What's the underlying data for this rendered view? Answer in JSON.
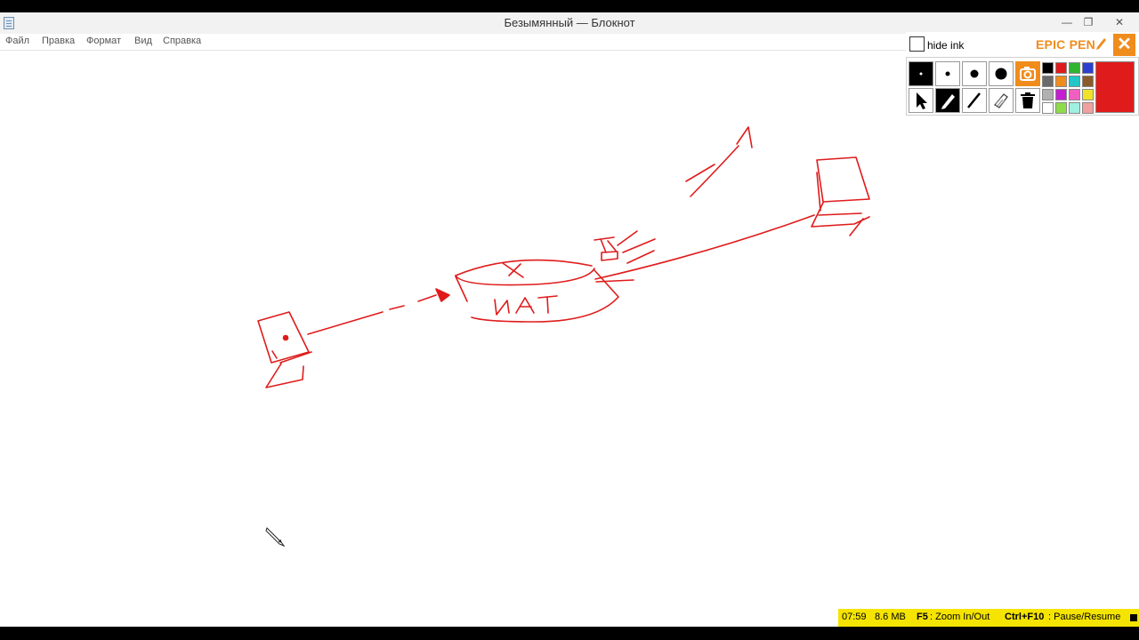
{
  "window": {
    "title": "Безымянный — Блокнот",
    "minimize_glyph": "—",
    "restore_glyph": "❐",
    "close_glyph": "✕"
  },
  "menu": [
    {
      "label": "Файл"
    },
    {
      "label": "Правка"
    },
    {
      "label": "Формат"
    },
    {
      "label": "Вид"
    },
    {
      "label": "Справка"
    }
  ],
  "epic_pen": {
    "hide_ink_label": "hide ink",
    "brand": "EPIC PEN",
    "close_glyph": "✕",
    "selected_color": "#e01b1b",
    "palette": [
      "#000000",
      "#e01b1b",
      "#2fb52f",
      "#2b3fd1",
      "#6a6a6a",
      "#f08c1c",
      "#23c6c6",
      "#8a5a2b",
      "#b0b0b0",
      "#c21fd0",
      "#f060c0",
      "#f0e22a",
      "#ffffff",
      "#8edc4a",
      "#a0f0e0",
      "#f0a0a0"
    ],
    "accent": "#f08c1c"
  },
  "drawing": {
    "ink_color": "#e01b1b",
    "nat_label": "NAT"
  },
  "status": {
    "time": "07:59",
    "size": "8.6 MB",
    "zoom_key": "F5",
    "zoom_label": ": Zoom In/Out",
    "pause_key": "Ctrl+F10",
    "pause_label": ": Pause/Resume"
  }
}
